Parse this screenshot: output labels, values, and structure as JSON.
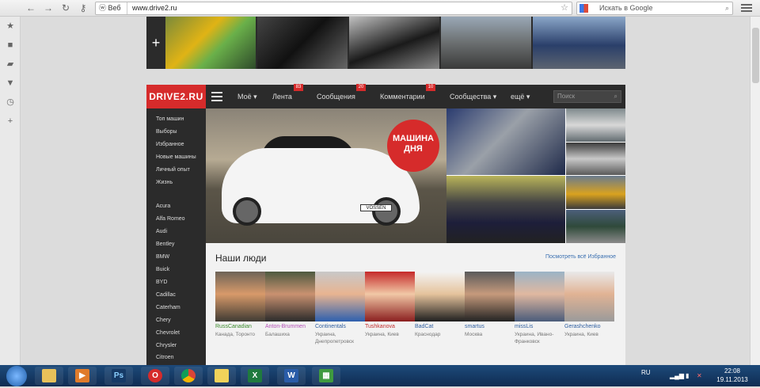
{
  "browser": {
    "site_chip": "Веб",
    "url": "www.drive2.ru",
    "search_placeholder": "Искать в Google"
  },
  "site": {
    "logo": "DRIVE2.RU",
    "nav": [
      {
        "label": "Моё ▾"
      },
      {
        "label": "Лента",
        "badge": "83"
      },
      {
        "label": "Сообщения",
        "badge": "20"
      },
      {
        "label": "Комментарии",
        "badge": "10"
      },
      {
        "label": "Сообщества ▾"
      },
      {
        "label": "ещё ▾"
      }
    ],
    "search_placeholder": "Поиск",
    "menu": [
      "Топ машин",
      "Выборы",
      "Избранное",
      "Новые машины",
      "Личный опыт",
      "Жизнь"
    ],
    "brands": [
      "Acura",
      "Alfa Romeo",
      "Audi",
      "Bentley",
      "BMW",
      "Buick",
      "BYD",
      "Cadillac",
      "Caterham",
      "Chery",
      "Chevrolet",
      "Chrysler",
      "Citroen"
    ],
    "hero_badge_line1": "МАШИНА",
    "hero_badge_line2": "ДНЯ",
    "hero_plate": "VOSSEN",
    "people_title": "Наши люди",
    "people_link": "Посмотреть всё Избранное",
    "people": [
      {
        "name": "RussCanadian",
        "city": "Канада, Торонто",
        "color": "#3b8a2c"
      },
      {
        "name": "Anton-Brummen",
        "city": "Балашиха",
        "color": "#b34fb6"
      },
      {
        "name": "Continentals",
        "city": "Украина, Днепропетровск",
        "color": "#2f5fa0"
      },
      {
        "name": "Tushkanova",
        "city": "Украина, Киев",
        "color": "#c42b2b"
      },
      {
        "name": "BadCat",
        "city": "Краснодар",
        "color": "#2f5fa0"
      },
      {
        "name": "smartus",
        "city": "Москва",
        "color": "#2f5fa0"
      },
      {
        "name": "missLis",
        "city": "Украина, Ивано-Франковск",
        "color": "#2f5fa0"
      },
      {
        "name": "Gerashchenko",
        "city": "Украина, Киев",
        "color": "#2f5fa0"
      }
    ]
  },
  "taskbar": {
    "lang": "RU",
    "time": "22:08",
    "date": "19.11.2013"
  },
  "colors": {
    "brand": "#d62b2b",
    "header": "#2b2b2b"
  }
}
